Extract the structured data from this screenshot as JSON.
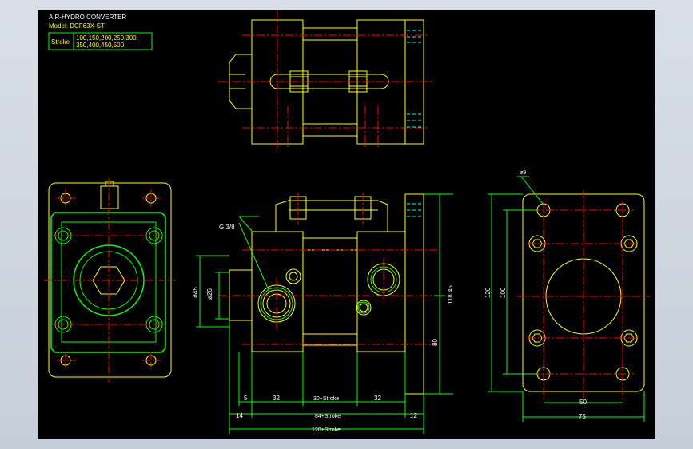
{
  "title_block": {
    "title": "AIR-HYDRO CONVERTER",
    "model": "Model: DCF63X-ST",
    "stroke_label": "Stroke",
    "stroke_values_line1": "100,150,200,250,300,",
    "stroke_values_line2": "350,400,450,500"
  },
  "annotations": {
    "port": "G 3/8",
    "dia_outer": "ø45",
    "dia_inner": "ø26",
    "height_total": "118.45",
    "height_center": "80",
    "hole_dia": "ø9",
    "rear_height_outer": "120",
    "rear_height_inner": "100",
    "rear_width_inner": "50",
    "rear_width_outer": "75",
    "dim_5": "5",
    "dim_32a": "32",
    "dim_30": "30+Stroke",
    "dim_32b": "32",
    "dim_14": "14",
    "dim_84": "84+Stroke",
    "dim_12": "12",
    "dim_120": "120+Stroke"
  },
  "colors": {
    "background": "#000000",
    "outline": "#ffff00",
    "dimension": "#00ff00",
    "centerline": "#ff0000",
    "text": "#ffffff",
    "hidden": "#00ffff",
    "frame": "#d0d8e2"
  }
}
